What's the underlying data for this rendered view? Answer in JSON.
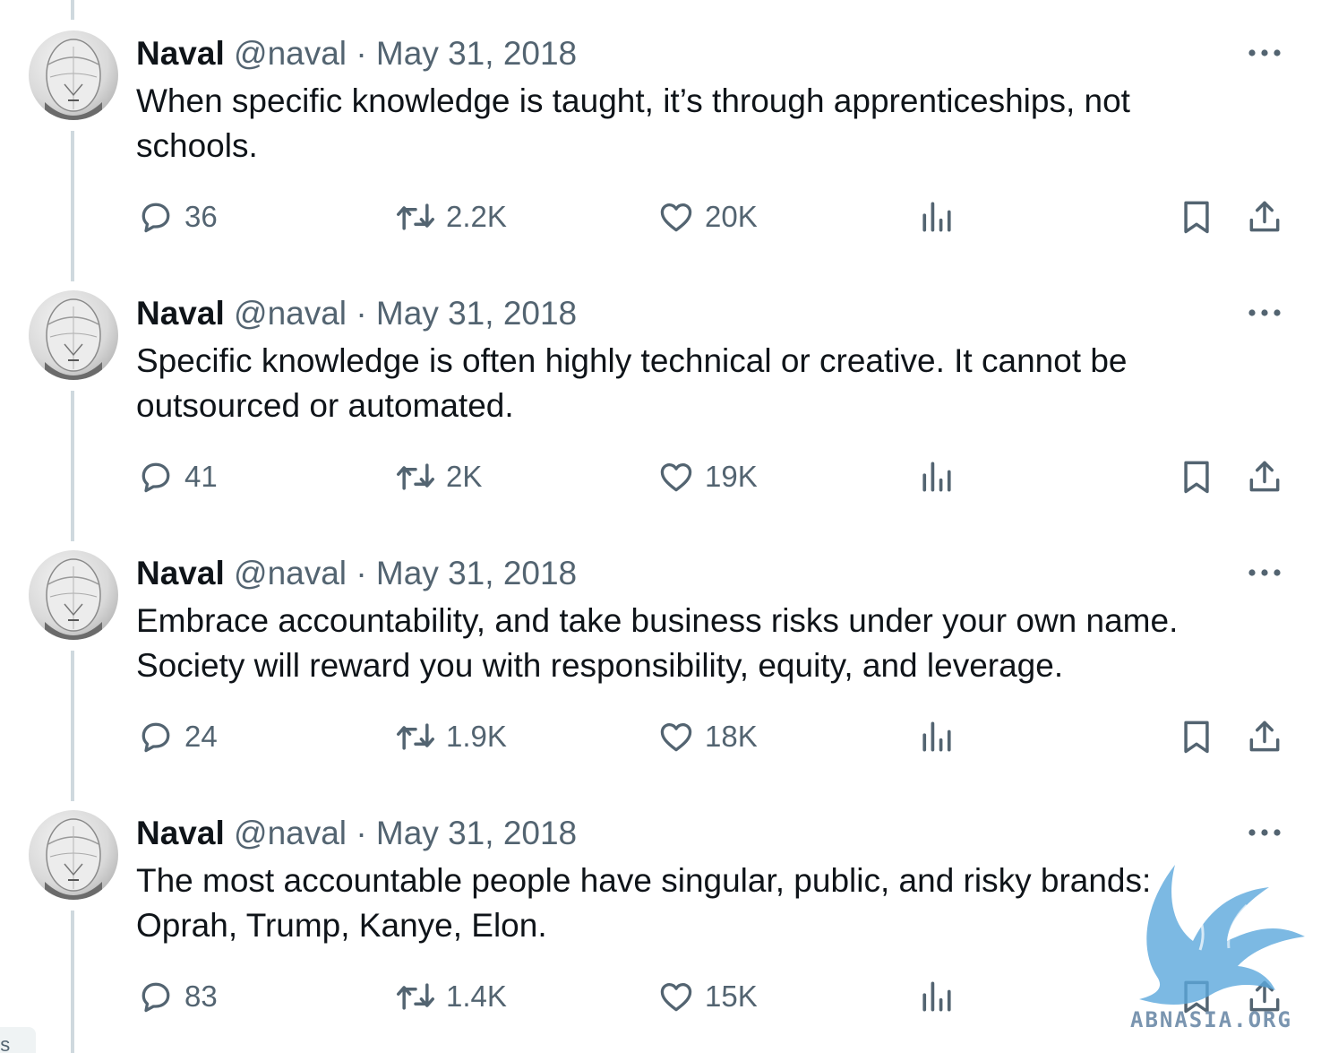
{
  "tweets": [
    {
      "name": "Naval",
      "handle": "@naval",
      "separator": "·",
      "date": "May 31, 2018",
      "text": "When specific knowledge is taught, it’s through apprenticeships, not schools.",
      "replies": "36",
      "reposts": "2.2K",
      "likes": "20K"
    },
    {
      "name": "Naval",
      "handle": "@naval",
      "separator": "·",
      "date": "May 31, 2018",
      "text": "Specific knowledge is often highly technical or creative. It cannot be outsourced or automated.",
      "replies": "41",
      "reposts": "2K",
      "likes": "19K"
    },
    {
      "name": "Naval",
      "handle": "@naval",
      "separator": "·",
      "date": "May 31, 2018",
      "text": "Embrace accountability, and take business risks under your own name. Society will reward you with responsibility, equity, and leverage.",
      "replies": "24",
      "reposts": "1.9K",
      "likes": "18K"
    },
    {
      "name": "Naval",
      "handle": "@naval",
      "separator": "·",
      "date": "May 31, 2018",
      "text": "The most accountable people have singular, public, and risky brands: Oprah, Trump, Kanye, Elon.",
      "replies": "83",
      "reposts": "1.4K",
      "likes": "15K"
    }
  ],
  "icons": {
    "reply": "reply-bubble-icon",
    "repost": "repost-arrows-icon",
    "like": "heart-icon",
    "views": "bar-chart-icon",
    "bookmark": "bookmark-icon",
    "share": "share-upload-icon",
    "more": "more-dots-icon"
  },
  "watermark": {
    "text": "ABNASIA.ORG"
  },
  "side_tab": {
    "text": "ds"
  },
  "colors": {
    "text": "#0f1419",
    "secondary": "#536471",
    "thread_line": "#cfd9de",
    "watermark": "#5ba7dc"
  }
}
